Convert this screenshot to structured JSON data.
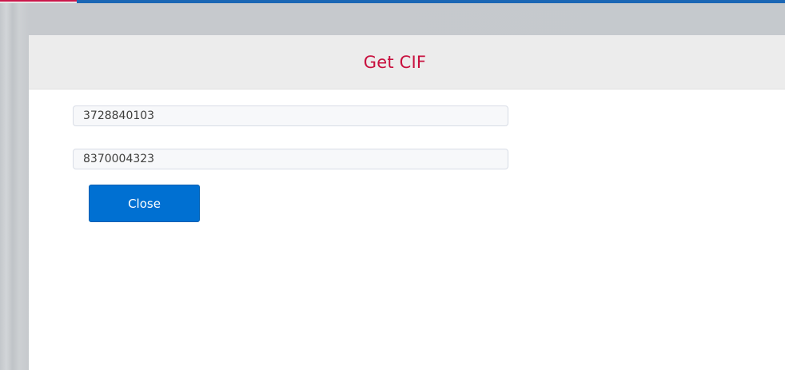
{
  "modal": {
    "title": "Get CIF",
    "fields": [
      {
        "value": "3728840103"
      },
      {
        "value": "8370004323"
      }
    ],
    "close_label": "Close"
  },
  "colors": {
    "title": "#c8103e",
    "button": "#0070d2",
    "top_bar": "#1b67b5"
  }
}
